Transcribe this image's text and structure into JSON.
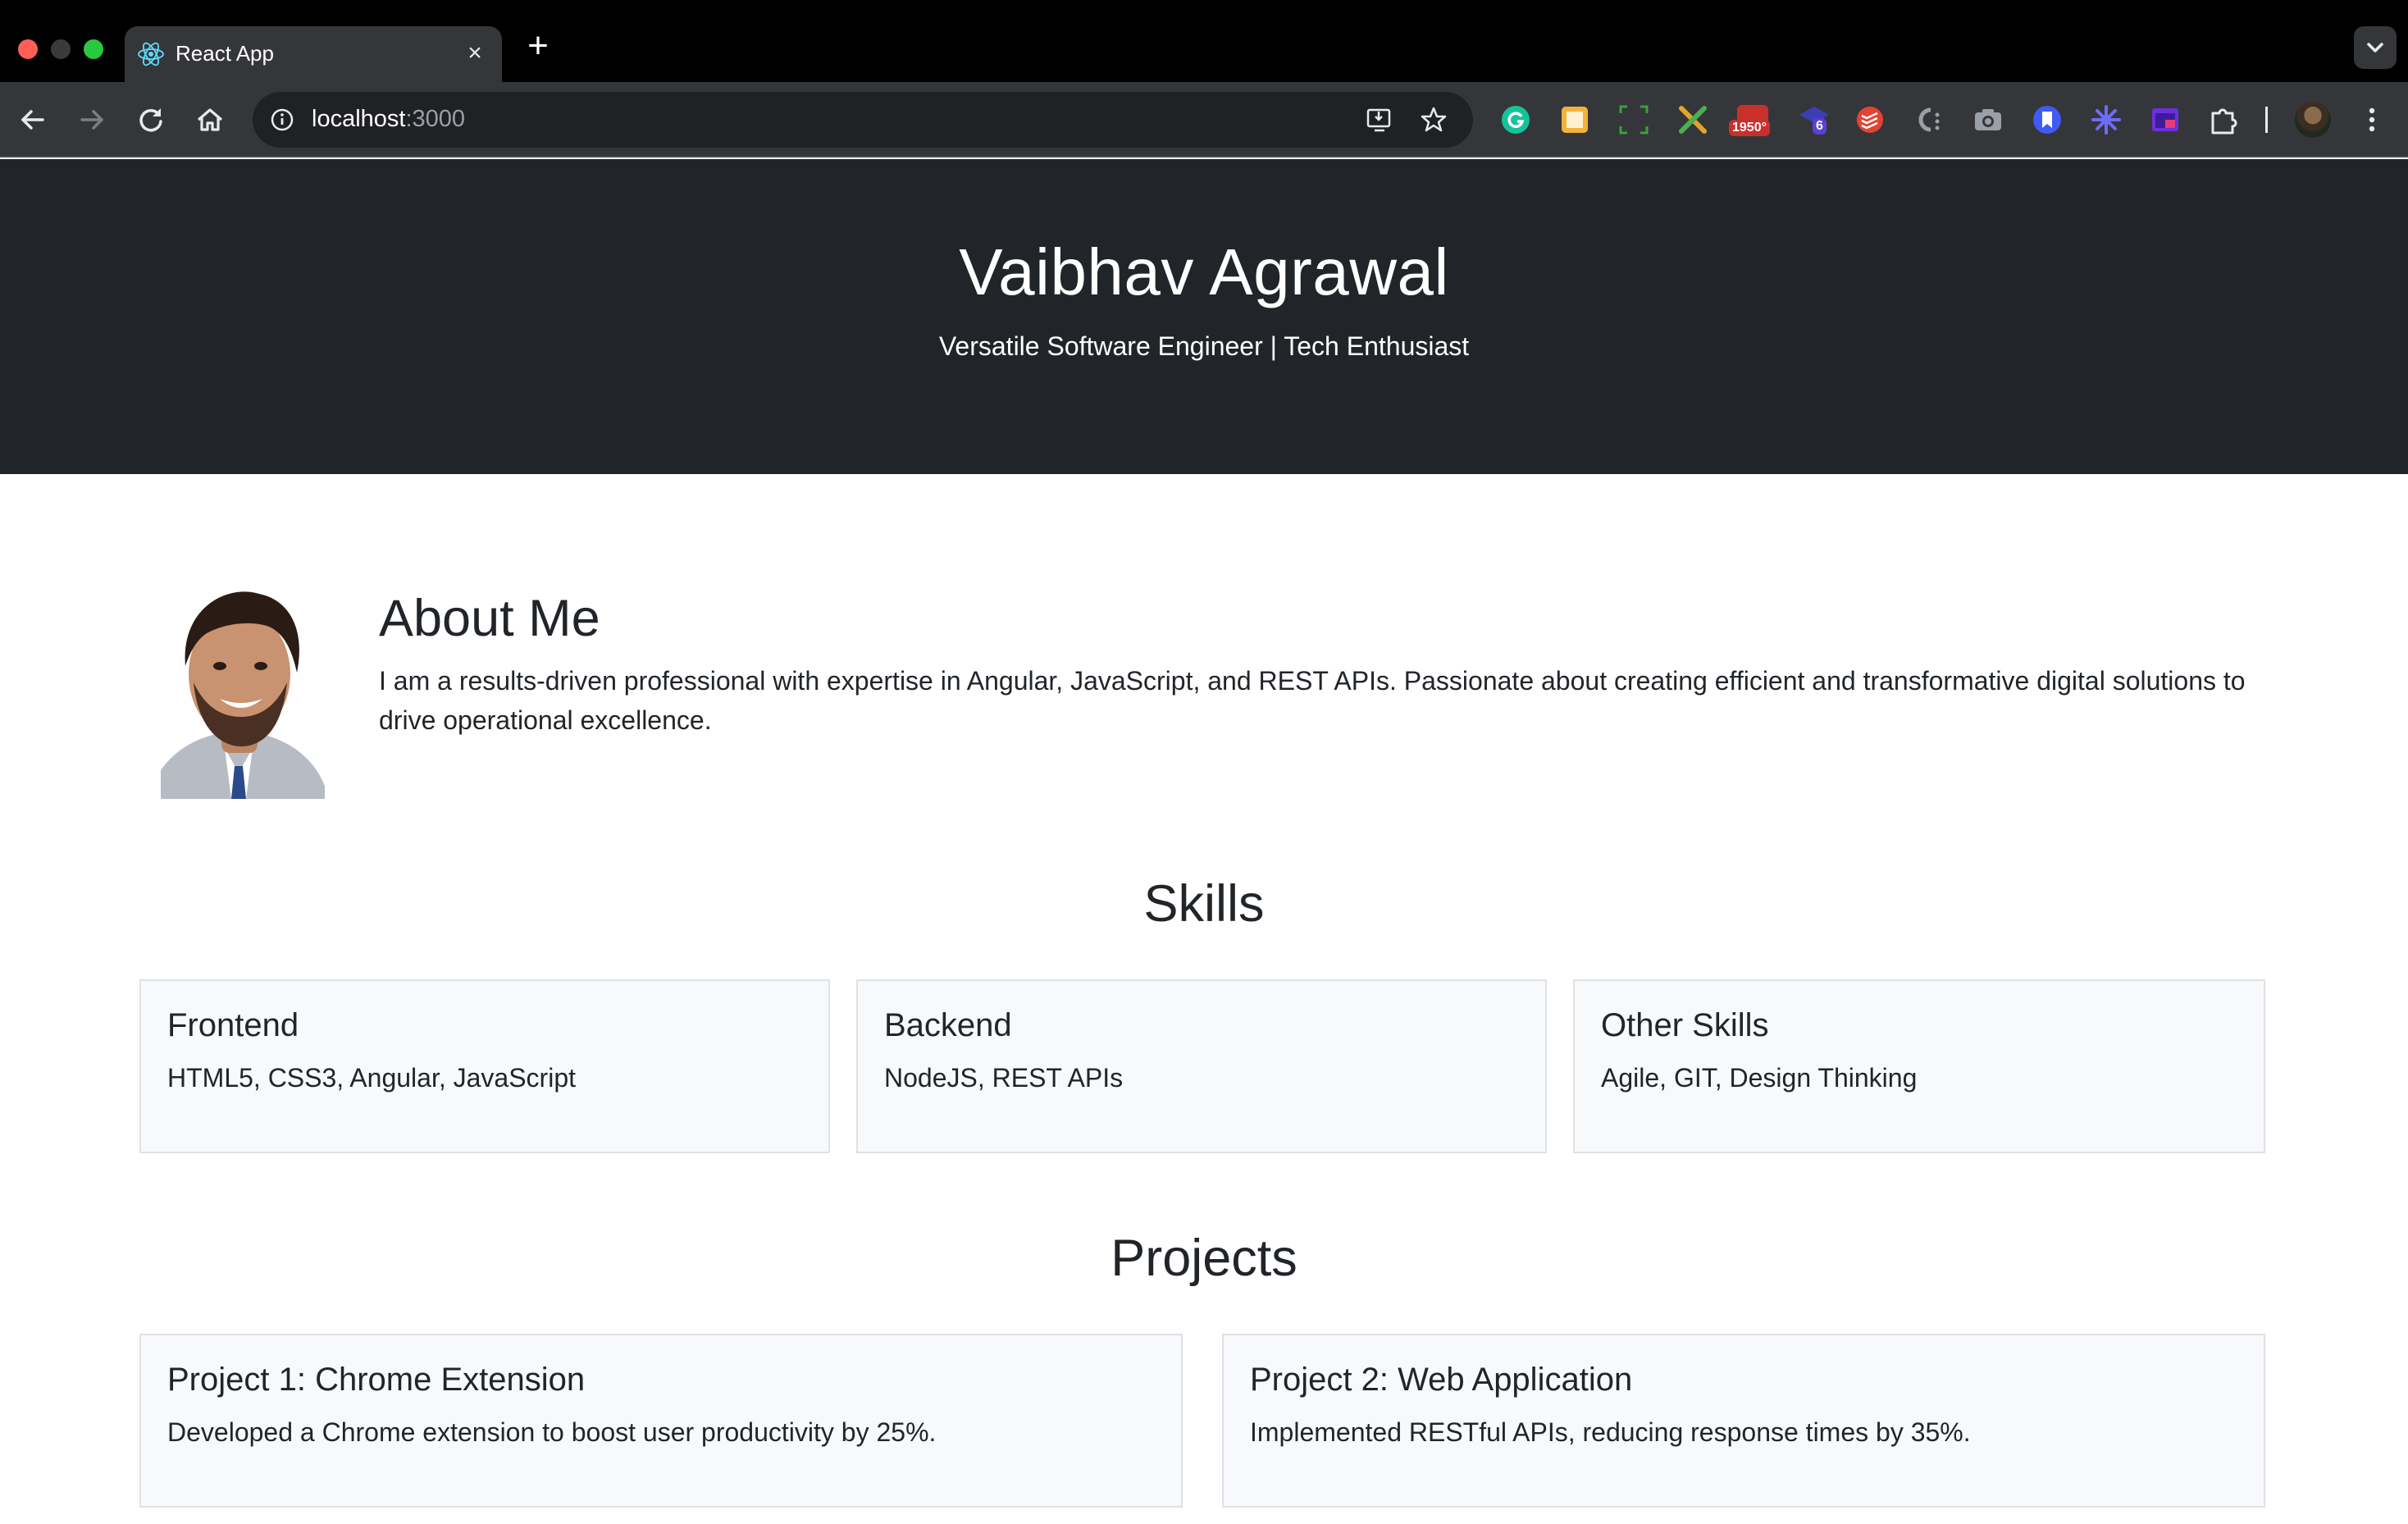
{
  "browser": {
    "tab_title": "React App",
    "url_host": "localhost",
    "url_port": ":3000",
    "extensions": [
      {
        "name": "grammarly-icon"
      },
      {
        "name": "notes-extension-icon"
      },
      {
        "name": "screenshot-region-icon"
      },
      {
        "name": "tools-extension-icon"
      },
      {
        "name": "weather-extension-icon",
        "badge": "1950°"
      },
      {
        "name": "tasks-extension-icon",
        "badge": "6"
      },
      {
        "name": "todoist-icon"
      },
      {
        "name": "code-extension-icon"
      },
      {
        "name": "camera-extension-icon"
      },
      {
        "name": "bookmark-extension-icon"
      },
      {
        "name": "sparkle-extension-icon"
      },
      {
        "name": "window-extension-icon"
      },
      {
        "name": "extensions-puzzle-icon"
      }
    ]
  },
  "hero": {
    "name": "Vaibhav Agrawal",
    "tagline": "Versatile Software Engineer | Tech Enthusiast"
  },
  "about": {
    "title": "About Me",
    "text": "I am a results-driven professional with expertise in Angular, JavaScript, and REST APIs. Passionate about creating efficient and transformative digital solutions to drive operational excellence."
  },
  "skills": {
    "title": "Skills",
    "cards": [
      {
        "title": "Frontend",
        "text": "HTML5, CSS3, Angular, JavaScript"
      },
      {
        "title": "Backend",
        "text": "NodeJS, REST APIs"
      },
      {
        "title": "Other Skills",
        "text": "Agile, GIT, Design Thinking"
      }
    ]
  },
  "projects": {
    "title": "Projects",
    "cards": [
      {
        "title": "Project 1: Chrome Extension",
        "text": "Developed a Chrome extension to boost user productivity by 25%."
      },
      {
        "title": "Project 2: Web Application",
        "text": "Implemented RESTful APIs, reducing response times by 35%."
      }
    ]
  },
  "colors": {
    "hero_bg": "#212529",
    "card_bg": "#f8f9fa",
    "card_border": "#dee2e6",
    "text": "#212529"
  }
}
